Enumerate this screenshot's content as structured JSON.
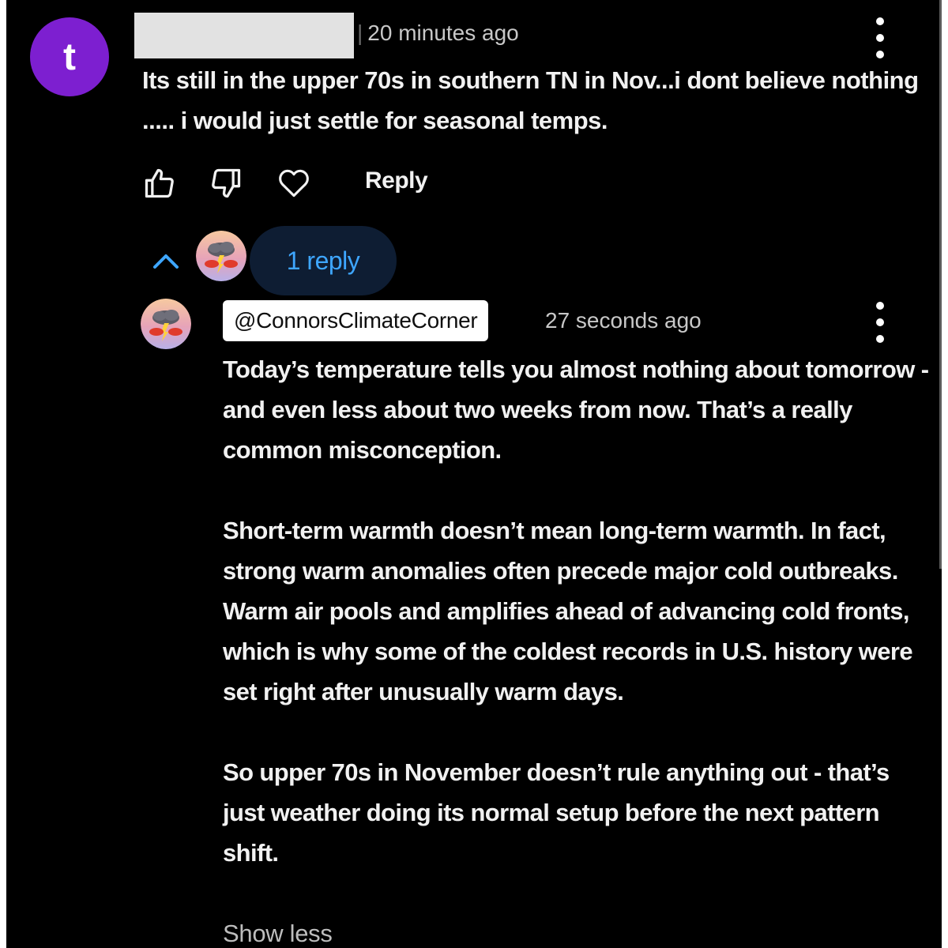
{
  "comment": {
    "avatar_letter": "t",
    "avatar_color": "#7d1fd0",
    "author_redacted": true,
    "timestamp": "20 minutes ago",
    "text": "Its still in the upper 70s in southern TN in Nov...i dont believe nothing ..... i would just settle for seasonal temps.",
    "actions": {
      "like_icon": "thumbs-up-icon",
      "dislike_icon": "thumbs-down-icon",
      "heart_icon": "heart-icon",
      "reply_label": "Reply"
    },
    "menu_icon": "more-vert-icon"
  },
  "replies_toggle": {
    "icon": "chevron-up-icon",
    "label": "1 reply",
    "label_color": "#3ea6ff"
  },
  "reply": {
    "author_handle": "@ConnorsClimateCorner",
    "timestamp": "27 seconds ago",
    "paragraphs": [
      "Today’s temperature tells you almost nothing about tomorrow - and even less about two weeks from now. That’s a really common misconception.",
      "Short-term warmth doesn’t mean long-term warmth. In fact, strong warm anomalies often precede major cold outbreaks. Warm air pools and amplifies ahead of advancing cold fronts, which is why some of the coldest records in U.S. history were set right after unusually warm days.",
      "So upper 70s in November doesn’t rule anything out - that’s just weather doing its normal setup before the next pattern shift."
    ],
    "show_less_label": "Show less",
    "menu_icon": "more-vert-icon"
  }
}
